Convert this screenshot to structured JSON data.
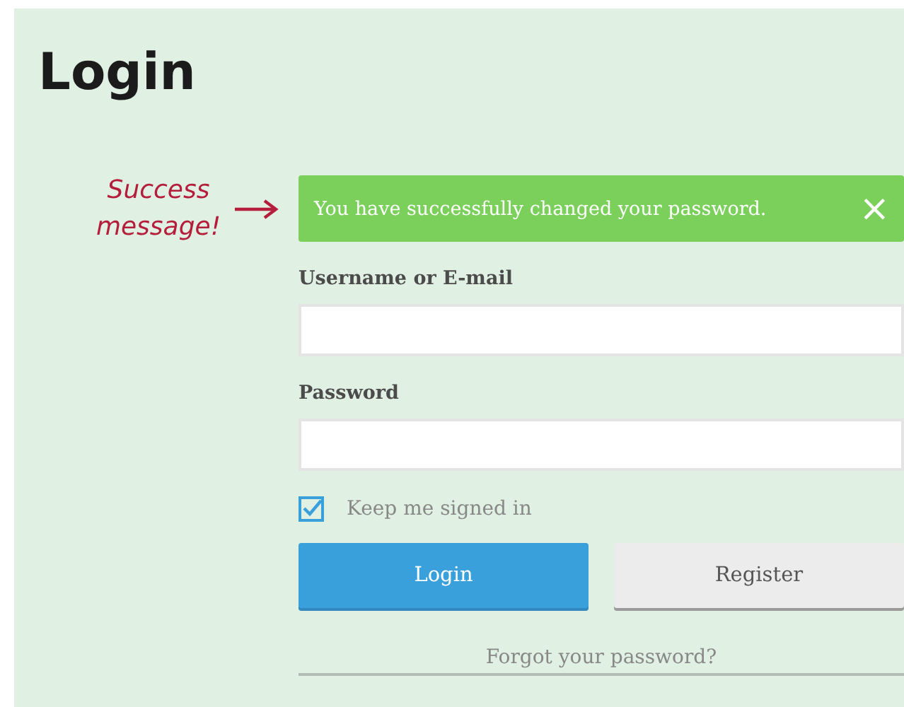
{
  "title": "Login",
  "annotation": {
    "text": "Success message!"
  },
  "alert": {
    "message": "You have successfully changed your password.",
    "close": "×"
  },
  "fields": [
    {
      "label": "Username or E-mail"
    },
    {
      "label": "Password"
    }
  ],
  "remember": {
    "label": "Keep me signed in",
    "checked": true
  },
  "buttons": [
    {
      "label": "Login",
      "kind": "primary"
    },
    {
      "label": "Register",
      "kind": "secondary"
    }
  ],
  "forgot_link": "Forgot your password?"
}
